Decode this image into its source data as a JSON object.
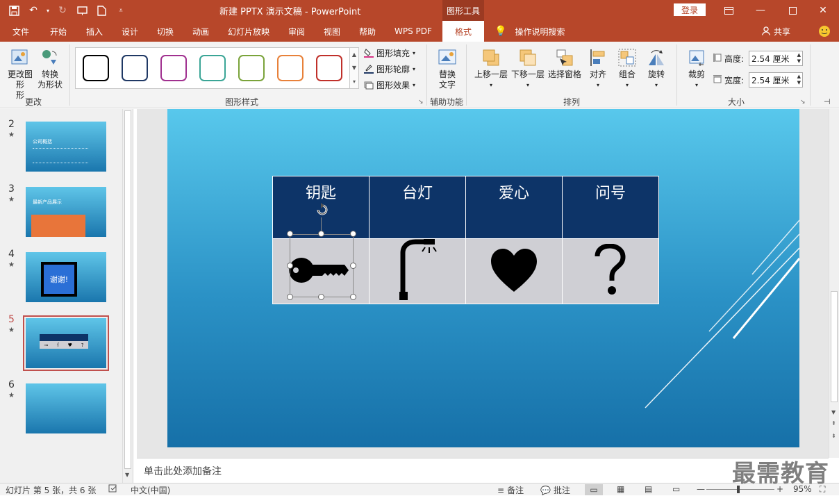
{
  "window": {
    "title": "新建 PPTX 演示文稿  -  PowerPoint",
    "context_group": "图形工具",
    "login_label": "登录"
  },
  "tabs": [
    "文件",
    "开始",
    "插入",
    "设计",
    "切换",
    "动画",
    "幻灯片放映",
    "审阅",
    "视图",
    "帮助",
    "WPS PDF",
    "格式"
  ],
  "tell_me": "操作说明搜索",
  "share": "共享",
  "ribbon": {
    "change_group": {
      "label": "更改",
      "btn1": "更改图形",
      "btn1b": "形",
      "btn2": "转换",
      "btn2b": "为形状"
    },
    "styles_group": {
      "label": "图形样式",
      "fill": "图形填充",
      "outline": "图形轮廓",
      "effects": "图形效果",
      "swatches": [
        "#000000",
        "#1f3864",
        "#a0308f",
        "#3aa596",
        "#7aa33a",
        "#e8813a",
        "#c0302a"
      ]
    },
    "access_group": {
      "label": "辅助功能",
      "alt_text": "替换",
      "alt_text_b": "文字"
    },
    "arrange_group": {
      "label": "排列",
      "forward": "上移一层",
      "backward": "下移一层",
      "pane": "选择窗格",
      "align": "对齐",
      "group": "组合",
      "rotate": "旋转"
    },
    "size_group": {
      "label": "大小",
      "crop": "裁剪",
      "height_label": "高度:",
      "height_value": "2.54 厘米",
      "width_label": "宽度:",
      "width_value": "2.54 厘米"
    }
  },
  "thumbnails": [
    {
      "num": "2",
      "title": "公司概括"
    },
    {
      "num": "3",
      "title": "最新产品展示"
    },
    {
      "num": "4",
      "title": "谢谢!"
    },
    {
      "num": "5",
      "title": ""
    },
    {
      "num": "6",
      "title": ""
    }
  ],
  "slide": {
    "headers": [
      "钥匙",
      "台灯",
      "爱心",
      "问号"
    ]
  },
  "notes_placeholder": "单击此处添加备注",
  "status": {
    "slide_info": "幻灯片 第 5 张，共 6 张",
    "language": "中文(中国)",
    "notes": "备注",
    "comments": "批注",
    "zoom": "95%"
  },
  "watermark": "最需教育",
  "colors": {
    "accent": "#b7472a",
    "table_header": "#0d3468",
    "table_cell": "#cfcfd4"
  }
}
